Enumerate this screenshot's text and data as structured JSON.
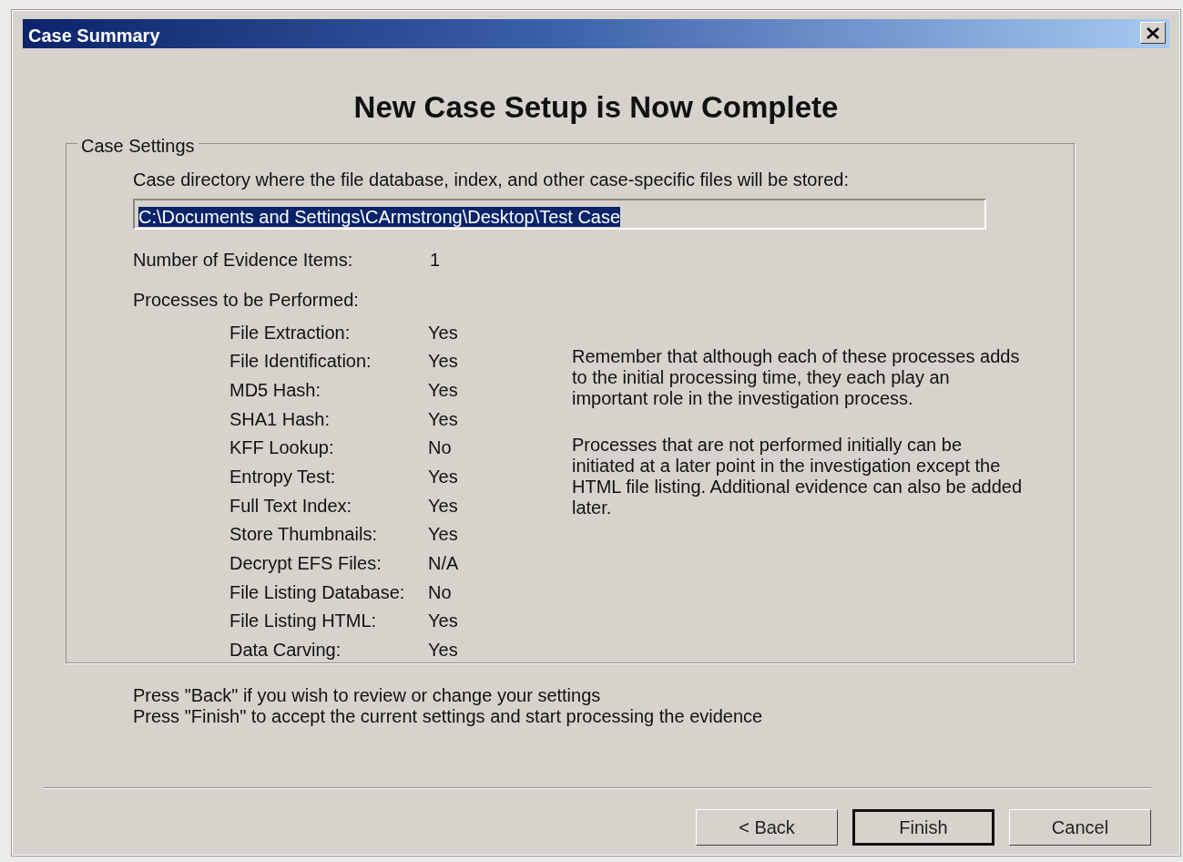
{
  "window": {
    "title": "Case Summary"
  },
  "heading": "New Case Setup is Now Complete",
  "case_settings": {
    "legend": "Case Settings",
    "directory_label": "Case directory where the file database, index, and other case-specific files will be stored:",
    "directory_field": {
      "value": "C:\\Documents and Settings\\CArmstrong\\Desktop\\Test Case",
      "text_selected": true
    },
    "evidence_label": "Number of Evidence Items:",
    "evidence_value": "1",
    "processes_label": "Processes to be Performed:",
    "processes": [
      {
        "label": "File Extraction:",
        "value": "Yes"
      },
      {
        "label": "File Identification:",
        "value": "Yes"
      },
      {
        "label": "MD5 Hash:",
        "value": "Yes"
      },
      {
        "label": "SHA1 Hash:",
        "value": "Yes"
      },
      {
        "label": "KFF Lookup:",
        "value": "No"
      },
      {
        "label": "Entropy Test:",
        "value": "Yes"
      },
      {
        "label": "Full Text Index:",
        "value": "Yes"
      },
      {
        "label": "Store Thumbnails:",
        "value": "Yes"
      },
      {
        "label": "Decrypt EFS Files:",
        "value": "N/A"
      },
      {
        "label": "File Listing Database:",
        "value": "No"
      },
      {
        "label": "File Listing HTML:",
        "value": "Yes"
      },
      {
        "label": "Data Carving:",
        "value": "Yes"
      }
    ],
    "notes": [
      "Remember that although each of these processes adds to the initial processing time, they each play an important role in the investigation process.",
      "Processes that are not performed initially can be initiated at a later point in the investigation except the HTML file listing. Additional evidence can also be added later."
    ]
  },
  "instructions": [
    "Press \"Back\" if you wish to review or change your settings",
    "Press \"Finish\" to accept the current settings and start processing the evidence"
  ],
  "buttons": [
    {
      "label": "< Back",
      "default": false
    },
    {
      "label": "Finish",
      "default": true
    },
    {
      "label": "Cancel",
      "default": false
    }
  ]
}
